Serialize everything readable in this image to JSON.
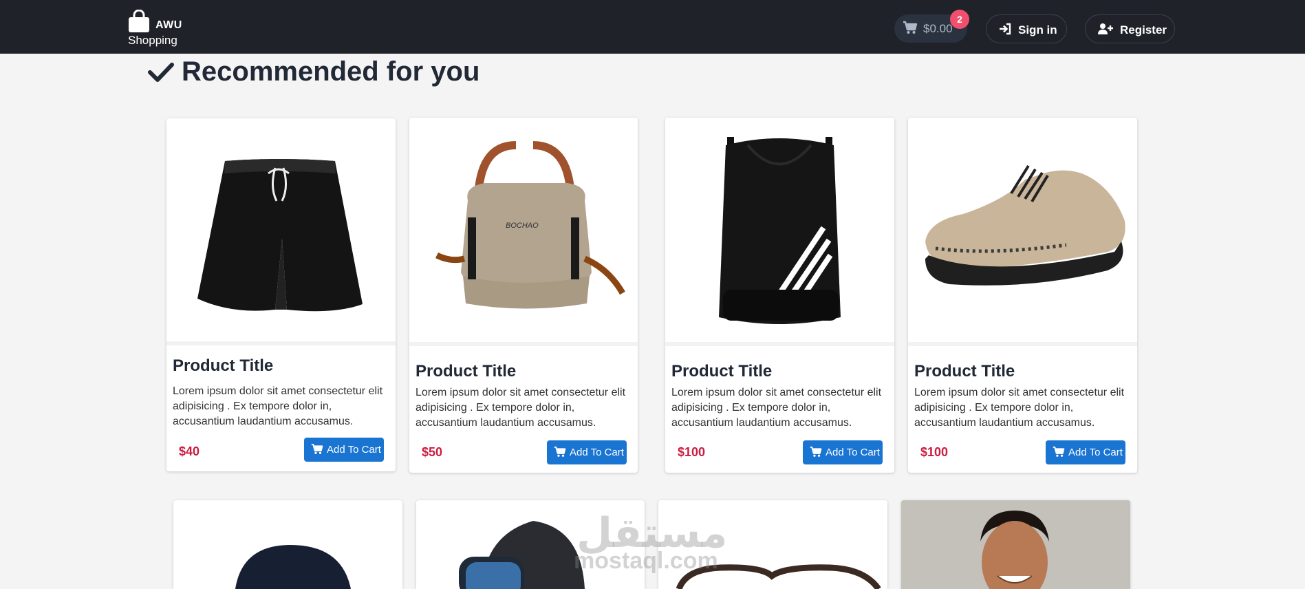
{
  "nav": {
    "brand_name": "AWU",
    "brand_sub": "Shopping",
    "cart_total": "$0.00",
    "cart_count": "2",
    "signin_label": "Sign in",
    "register_label": "Register"
  },
  "section": {
    "title": "Recommended for you"
  },
  "products": [
    {
      "title": "Product Title",
      "description": "Lorem ipsum dolor sit amet consectetur elit adipisicing . Ex tempore dolor in, accusantium laudantium accusamus.",
      "price": "$40",
      "button": "Add To Cart",
      "image": "black-shorts"
    },
    {
      "title": "Product Title",
      "description": "Lorem ipsum dolor sit amet consectetur elit adipisicing . Ex tempore dolor in, accusantium laudantium accusamus.",
      "price": "$50",
      "button": "Add To Cart",
      "image": "duffel-bag"
    },
    {
      "title": "Product Title",
      "description": "Lorem ipsum dolor sit amet consectetur elit adipisicing . Ex tempore dolor in, accusantium laudantium accusamus.",
      "price": "$100",
      "button": "Add To Cart",
      "image": "drawstring-backpack"
    },
    {
      "title": "Product Title",
      "description": "Lorem ipsum dolor sit amet consectetur elit adipisicing . Ex tempore dolor in, accusantium laudantium accusamus.",
      "price": "$100",
      "button": "Add To Cart",
      "image": "knit-sneaker"
    }
  ],
  "second_row": [
    {
      "image": "cap"
    },
    {
      "image": "smartwatch"
    },
    {
      "image": "sunglasses"
    },
    {
      "image": "smiling-man"
    }
  ],
  "watermark": {
    "arabic": "مستقل",
    "latin": "mostaql.com"
  },
  "colors": {
    "navbar": "#1f2329",
    "accent": "#1a74d2",
    "price": "#cc1b3f",
    "badge": "#f0506e"
  }
}
